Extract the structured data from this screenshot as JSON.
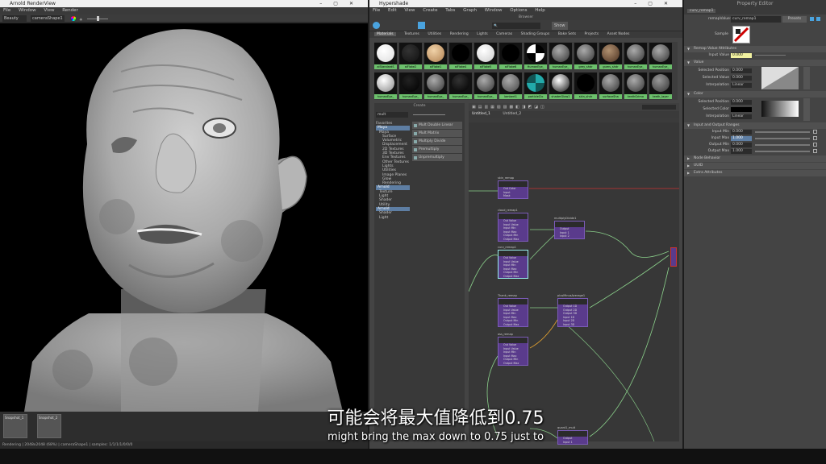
{
  "render_view": {
    "title": "Arnold RenderView",
    "menu": [
      "File",
      "Window",
      "View",
      "Render"
    ],
    "aov": "Beauty",
    "camera": "cameraShape1",
    "snapshots": [
      "Snapshot_1",
      "Snapshot_2"
    ],
    "status": "Rendering | 2048x2048 (68%) | cameraShape1 | samples: 1/1/1/1/0/0/0"
  },
  "hypershade": {
    "title": "Hypershade",
    "menu": [
      "File",
      "Edit",
      "View",
      "Create",
      "Tabs",
      "Graph",
      "Window",
      "Options",
      "Help"
    ],
    "browser_label": "Browser",
    "show_label": "Show",
    "browser_tabs": [
      "Materials",
      "Textures",
      "Utilities",
      "Rendering",
      "Lights",
      "Cameras",
      "Shading Groups",
      "Bake Sets",
      "Projects",
      "Asset Nodes"
    ],
    "swatches_row1": [
      "aiStandardS",
      "aiFlake2",
      "aiFlake1",
      "aiFlake4",
      "aiFlake5",
      "aiFlake6",
      "HumanEye_",
      "humanEye_",
      "grey_shdr",
      "gums_shdr",
      "humanEye_",
      "humanEye_"
    ],
    "swatches_row2": [
      "humanEye_",
      "humanEye_",
      "humanEye_",
      "humanEye_",
      "humanEye_",
      "lambert1",
      "particleClo",
      "shaderGlow1",
      "skin_shdr",
      "surfaceSha",
      "teethGrimo",
      "teeth_layer"
    ],
    "create_label": "Create",
    "create_search": "mult",
    "create_tree": [
      "Favorites",
      "Maya",
      "Maya",
      "Surface",
      "Volumetric",
      "Displacement",
      "2D Textures",
      "3D Textures",
      "Env Textures",
      "Other Textures",
      "Lights",
      "Utilities",
      "Image Planes",
      "Glow",
      "Rendering",
      "Arnold",
      "Texture",
      "Light",
      "Shader",
      "Utility",
      "Arnold",
      "Shader",
      "Light"
    ],
    "create_nodes": [
      "Mult Double Linear",
      "Mult Matrix",
      "Multiply Divide",
      "Premultiply",
      "Unpremultiply"
    ],
    "editor_tabs": [
      "Untitled_1",
      "Untitled_2"
    ],
    "nodes": [
      {
        "name": "skin_remap",
        "rows": [
          "",
          "Out Color",
          "Input",
          "Mask"
        ]
      },
      {
        "name": "cloud_remap1",
        "rows": [
          "",
          "Out Value",
          "Input Value",
          "Input Min",
          "Input Max",
          "Output Min",
          "Output Max"
        ]
      },
      {
        "name": "multiplyDivide1",
        "rows": [
          "",
          "Output",
          "Input 1",
          "Input 2"
        ]
      },
      {
        "name": "curv_remap1",
        "rows": [
          "",
          "Out Value",
          "Input Value",
          "Input Min",
          "Input Max",
          "Output Min",
          "Output Max"
        ]
      },
      {
        "name": "Thank_remap",
        "rows": [
          "",
          "Out Value",
          "Input Value",
          "Input Min",
          "Input Max",
          "Output Min",
          "Output Max"
        ]
      },
      {
        "name": "plusMinusAverage1",
        "rows": [
          "",
          "Output 1D",
          "Output 2D",
          "Output 3D",
          "Input 1D",
          "Input 2D",
          "Input 3D"
        ]
      },
      {
        "name": "ass_remap",
        "rows": [
          "",
          "Out Value",
          "Input Value",
          "Input Min",
          "Input Max",
          "Output Min",
          "Output Max"
        ]
      },
      {
        "name": "quant1_mult",
        "rows": [
          "",
          "Output",
          "Input 1"
        ]
      }
    ]
  },
  "property_editor": {
    "title": "Property Editor",
    "node_tab": "curv_remap1",
    "type_label": "remapValue:",
    "node_name": "curv_remap1",
    "presets": "Presets",
    "sample_label": "Sample",
    "sections": {
      "attrs": "Remap Value Attributes",
      "value": "Value",
      "color": "Color",
      "ranges": "Input and Output Ranges",
      "node_behavior": "Node Behavior",
      "uuid": "UUID",
      "extra": "Extra Attributes"
    },
    "input_value": {
      "label": "Input Value",
      "value": "0.000"
    },
    "value_rows": [
      {
        "label": "Selected Position",
        "value": "0.000"
      },
      {
        "label": "Selected Value",
        "value": "0.000"
      },
      {
        "label": "Interpolation",
        "value": "Linear"
      }
    ],
    "color_rows": [
      {
        "label": "Selected Position",
        "value": "0.000"
      },
      {
        "label": "Selected Color",
        "value": ""
      },
      {
        "label": "Interpolation",
        "value": "Linear"
      }
    ],
    "ranges": [
      {
        "label": "Input Min",
        "value": "0.000"
      },
      {
        "label": "Input Max",
        "value": "1.000"
      },
      {
        "label": "Output Min",
        "value": "0.000"
      },
      {
        "label": "Output Max",
        "value": "1.000"
      }
    ]
  },
  "subtitles": {
    "zh": "可能会将最大值降低到0.75",
    "en": "might bring the max down to 0.75 just to"
  },
  "colors": {
    "node_body": "#5a3b8c",
    "swatch_label": "#6cc06c",
    "selection": "#5e7ea3"
  }
}
